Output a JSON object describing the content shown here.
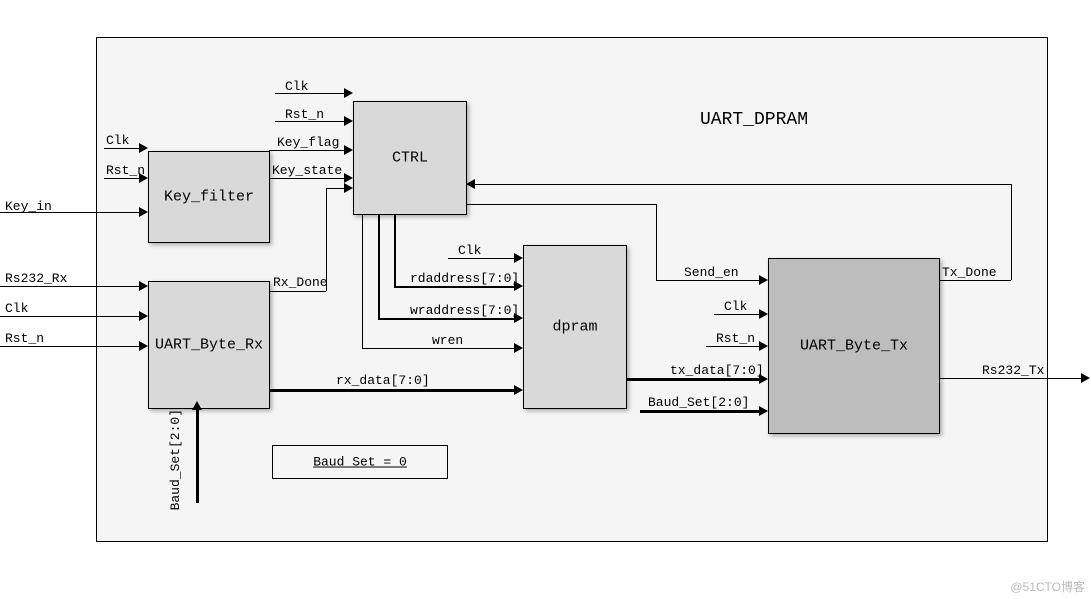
{
  "diagram_title": "UART_DPRAM",
  "blocks": {
    "key_filter": "Key_filter",
    "ctrl": "CTRL",
    "uart_rx": "UART_Byte_Rx",
    "dpram": "dpram",
    "uart_tx": "UART_Byte_Tx",
    "baud_note": "Baud_Set = 0"
  },
  "signals": {
    "clk": "Clk",
    "rst_n": "Rst_n",
    "key_in": "Key_in",
    "rs232_rx": "Rs232_Rx",
    "key_flag": "Key_flag",
    "key_state": "Key_state",
    "rx_done": "Rx_Done",
    "rx_data": "rx_data[7:0]",
    "rdaddress": "rdaddress[7:0]",
    "wraddress": "wraddress[7:0]",
    "wren": "wren",
    "tx_data": "tx_data[7:0]",
    "send_en": "Send_en",
    "tx_done": "Tx_Done",
    "rs232_tx": "Rs232_Tx",
    "baud_set_bus": "Baud_Set[2:0]"
  },
  "external_ports": {
    "key_filter_in": [
      "Clk",
      "Rst_n"
    ],
    "top_left_in": [
      "Key_in"
    ],
    "uart_rx_in": [
      "Rs232_Rx",
      "Clk",
      "Rst_n"
    ],
    "out": [
      "Rs232_Tx"
    ]
  },
  "watermark": "@51CTO博客",
  "chart_data": {
    "type": "diagram",
    "top_module": "UART_DPRAM",
    "blocks": [
      {
        "name": "Key_filter",
        "inputs": [
          "Clk",
          "Rst_n",
          "Key_in"
        ],
        "outputs": [
          "Key_flag",
          "Key_state"
        ]
      },
      {
        "name": "CTRL",
        "inputs": [
          "Clk",
          "Rst_n",
          "Key_flag",
          "Key_state",
          "Rx_Done",
          "Tx_Done"
        ],
        "outputs": [
          "rdaddress[7:0]",
          "wraddress[7:0]",
          "wren",
          "Send_en"
        ]
      },
      {
        "name": "UART_Byte_Rx",
        "inputs": [
          "Rs232_Rx",
          "Clk",
          "Rst_n",
          "Baud_Set[2:0]"
        ],
        "outputs": [
          "Rx_Done",
          "rx_data[7:0]"
        ]
      },
      {
        "name": "dpram",
        "inputs": [
          "Clk",
          "rdaddress[7:0]",
          "wraddress[7:0]",
          "wren",
          "rx_data[7:0]"
        ],
        "outputs": [
          "tx_data[7:0]"
        ]
      },
      {
        "name": "UART_Byte_Tx",
        "inputs": [
          "Send_en",
          "Clk",
          "Rst_n",
          "tx_data[7:0]",
          "Baud_Set[2:0]"
        ],
        "outputs": [
          "Tx_Done",
          "Rs232_Tx"
        ]
      }
    ],
    "connections": [
      {
        "from": "Key_filter.Key_flag",
        "to": "CTRL.Key_flag"
      },
      {
        "from": "Key_filter.Key_state",
        "to": "CTRL.Key_state"
      },
      {
        "from": "UART_Byte_Rx.Rx_Done",
        "to": "CTRL.Rx_Done"
      },
      {
        "from": "UART_Byte_Rx.rx_data[7:0]",
        "to": "dpram.data"
      },
      {
        "from": "CTRL.rdaddress[7:0]",
        "to": "dpram.rdaddress"
      },
      {
        "from": "CTRL.wraddress[7:0]",
        "to": "dpram.wraddress"
      },
      {
        "from": "CTRL.wren",
        "to": "dpram.wren"
      },
      {
        "from": "CTRL.Send_en",
        "to": "UART_Byte_Tx.Send_en"
      },
      {
        "from": "dpram.tx_data[7:0]",
        "to": "UART_Byte_Tx.tx_data"
      },
      {
        "from": "UART_Byte_Tx.Tx_Done",
        "to": "CTRL"
      },
      {
        "from": "UART_Byte_Tx.Rs232_Tx",
        "to": "external"
      }
    ],
    "constants": [
      {
        "name": "Baud_Set",
        "value": 0
      }
    ]
  }
}
